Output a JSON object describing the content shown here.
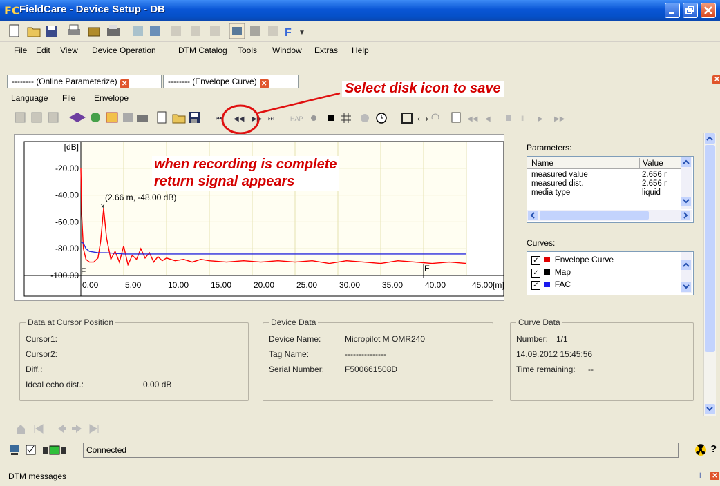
{
  "window": {
    "logo": "FC",
    "title": "FieldCare - Device Setup - DB"
  },
  "menubar": [
    "File",
    "Edit",
    "View",
    "Device Operation",
    "DTM Catalog",
    "Tools",
    "Window",
    "Extras",
    "Help"
  ],
  "tabs": [
    {
      "label": "-------- (Online Parameterize)"
    },
    {
      "label": "-------- (Envelope Curve)"
    }
  ],
  "submenu": [
    "Language",
    "File",
    "Envelope"
  ],
  "annotations": {
    "save_hint": "Select disk icon to save",
    "recording_hint_line1": "when recording is complete",
    "recording_hint_line2": "return signal appears"
  },
  "chart_data": {
    "type": "line",
    "ylabel": "[dB]",
    "xunit": "45.00[m]",
    "x_ticks": [
      "0.00",
      "5.00",
      "10.00",
      "15.00",
      "20.00",
      "25.00",
      "30.00",
      "35.00",
      "40.00"
    ],
    "y_ticks": [
      "-20.00",
      "-40.00",
      "-60.00",
      "-80.00",
      "-100.00"
    ],
    "xlim": [
      0,
      45
    ],
    "ylim": [
      -100,
      0
    ],
    "marker_label": "(2.66 m, -48.00 dB)",
    "marker": {
      "x": 2.66,
      "y": -48
    },
    "F_label": "F",
    "E_label": "E",
    "E_position": 40,
    "series": [
      {
        "color": "#ff0000",
        "x": [
          0,
          0.1,
          0.3,
          0.6,
          1.0,
          1.5,
          2.0,
          2.3,
          2.66,
          3.0,
          3.5,
          4.0,
          4.5,
          5.0,
          5.5,
          6.0,
          6.5,
          7.0,
          7.5,
          8.0,
          8.5,
          9.0,
          9.5,
          10.0,
          11,
          12,
          13,
          14,
          15,
          17,
          19,
          21,
          23,
          25,
          27,
          29,
          31,
          33,
          35,
          37,
          39,
          41,
          43,
          45
        ],
        "y": [
          -20,
          -55,
          -80,
          -88,
          -90,
          -90,
          -87,
          -75,
          -50,
          -72,
          -88,
          -82,
          -90,
          -78,
          -92,
          -85,
          -88,
          -80,
          -87,
          -83,
          -90,
          -86,
          -89,
          -87,
          -89,
          -88,
          -90,
          -88,
          -89,
          -90,
          -89,
          -90,
          -89,
          -90,
          -89,
          -91,
          -89,
          -90,
          -91,
          -89,
          -90,
          -91,
          -90,
          -91
        ]
      },
      {
        "color": "#2b2bdd",
        "x": [
          0,
          0.3,
          0.6,
          1,
          2,
          3,
          5,
          8,
          10,
          15,
          20,
          25,
          30,
          35,
          40,
          45
        ],
        "y": [
          -75,
          -76,
          -80,
          -82,
          -83,
          -83,
          -84,
          -84,
          -84,
          -84,
          -84,
          -84,
          -84,
          -84,
          -84,
          -84
        ]
      }
    ]
  },
  "parameters": {
    "title": "Parameters:",
    "headers": [
      "Name",
      "Value"
    ],
    "rows": [
      [
        "measured value",
        "2.656 r"
      ],
      [
        "measured dist.",
        "2.656 r"
      ],
      [
        "media type",
        "liquid"
      ]
    ]
  },
  "curves": {
    "title": "Curves:",
    "items": [
      {
        "label": "Envelope Curve",
        "color": "#e00000"
      },
      {
        "label": "Map",
        "color": "#000000"
      },
      {
        "label": "FAC",
        "color": "#1a1aee"
      }
    ]
  },
  "cursor_data": {
    "title": "Data at Cursor Position",
    "rows": [
      "Cursor1:",
      "Cursor2:",
      "Diff.:",
      "Ideal echo dist.:"
    ],
    "ideal_value": "0.00 dB"
  },
  "device_data": {
    "title": "Device Data",
    "rows": [
      [
        "Device Name:",
        "Micropilot M OMR240"
      ],
      [
        "Tag Name:",
        "---------------"
      ],
      [
        "Serial Number:",
        "F500661508D"
      ]
    ]
  },
  "curve_data": {
    "title": "Curve Data",
    "number_label": "Number:",
    "number_value": "1/1",
    "timestamp": "14.09.2012 15:45:56",
    "time_remaining_label": "Time remaining:",
    "time_remaining_value": "--"
  },
  "status": {
    "connection": "Connected"
  },
  "messages": {
    "label": "DTM messages"
  }
}
